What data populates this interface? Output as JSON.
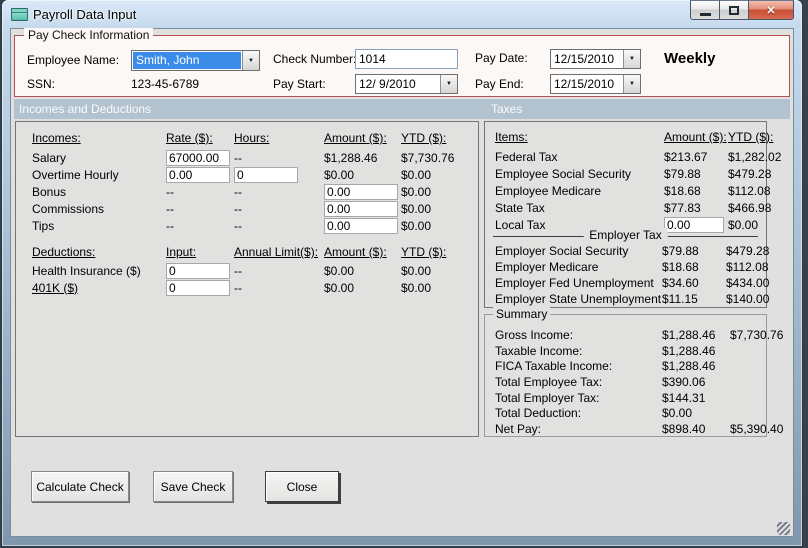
{
  "window": {
    "title": "Payroll Data Input"
  },
  "icons": {
    "combo_arrow": "▼",
    "close_glyph": "✕"
  },
  "paycheck": {
    "legend": "Pay Check Information",
    "employee_name_label": "Employee Name:",
    "employee_name_value": "Smith, John",
    "ssn_label": "SSN:",
    "ssn_value": "123-45-6789",
    "check_number_label": "Check Number:",
    "check_number_value": "1014",
    "pay_start_label": "Pay Start:",
    "pay_start_value": "12/ 9/2010",
    "pay_date_label": "Pay Date:",
    "pay_date_value": "12/15/2010",
    "pay_end_label": "Pay End:",
    "pay_end_value": "12/15/2010",
    "frequency": "Weekly"
  },
  "sections": {
    "left": "Incomes and Deductions",
    "right": "Taxes"
  },
  "incomes": {
    "headers": {
      "name": "Incomes:",
      "rate": "Rate ($):",
      "hours": "Hours:",
      "amount": "Amount ($):",
      "ytd": "YTD ($):"
    },
    "rows": [
      {
        "label": "Salary",
        "rate": "67000.00",
        "hours": "--",
        "amount": "$1,288.46",
        "ytd": "$7,730.76"
      },
      {
        "label": "Overtime Hourly",
        "rate": "0.00",
        "hours": "0",
        "amount": "$0.00",
        "ytd": "$0.00"
      },
      {
        "label": "Bonus",
        "rate": "--",
        "hours": "--",
        "amount": "0.00",
        "ytd": "$0.00"
      },
      {
        "label": "Commissions",
        "rate": "--",
        "hours": "--",
        "amount": "0.00",
        "ytd": "$0.00"
      },
      {
        "label": "Tips",
        "rate": "--",
        "hours": "--",
        "amount": "0.00",
        "ytd": "$0.00"
      }
    ]
  },
  "deductions": {
    "headers": {
      "name": "Deductions:",
      "input": "Input:",
      "limit": "Annual Limit($):",
      "amount": "Amount ($):",
      "ytd": "YTD ($):"
    },
    "rows": [
      {
        "label": "Health Insurance  ($)",
        "input": "0",
        "limit": "--",
        "amount": "$0.00",
        "ytd": "$0.00"
      },
      {
        "label": "401K  ($)",
        "input": "0",
        "limit": "--",
        "amount": "$0.00",
        "ytd": "$0.00"
      }
    ]
  },
  "taxes": {
    "headers": {
      "items": "Items:",
      "amount": "Amount ($):",
      "ytd": "YTD ($):"
    },
    "employee_rows": [
      {
        "label": "Federal Tax",
        "amount": "$213.67",
        "ytd": "$1,282.02"
      },
      {
        "label": "Employee Social Security",
        "amount": "$79.88",
        "ytd": "$479.28"
      },
      {
        "label": "Employee Medicare",
        "amount": "$18.68",
        "ytd": "$112.08"
      },
      {
        "label": "State Tax",
        "amount": "$77.83",
        "ytd": "$466.98"
      },
      {
        "label": "Local Tax",
        "amount": "0.00",
        "ytd": "$0.00"
      }
    ],
    "employer_label": "Employer Tax",
    "employer_rows": [
      {
        "label": "Employer Social Security",
        "amount": "$79.88",
        "ytd": "$479.28"
      },
      {
        "label": "Employer Medicare",
        "amount": "$18.68",
        "ytd": "$112.08"
      },
      {
        "label": "Employer Fed Unemployment",
        "amount": "$34.60",
        "ytd": "$434.00"
      },
      {
        "label": "Employer State Unemployment",
        "amount": "$11.15",
        "ytd": "$140.00"
      }
    ]
  },
  "summary": {
    "legend": "Summary",
    "rows": [
      {
        "label": "Gross Income:",
        "amount": "$1,288.46",
        "ytd": "$7,730.76"
      },
      {
        "label": "Taxable Income:",
        "amount": "$1,288.46",
        "ytd": ""
      },
      {
        "label": "FICA Taxable Income:",
        "amount": "$1,288.46",
        "ytd": ""
      },
      {
        "label": "Total Employee Tax:",
        "amount": "$390.06",
        "ytd": ""
      },
      {
        "label": "Total Employer Tax:",
        "amount": "$144.31",
        "ytd": ""
      },
      {
        "label": "Total Deduction:",
        "amount": "$0.00",
        "ytd": ""
      },
      {
        "label": "Net Pay:",
        "amount": "$898.40",
        "ytd": "$5,390.40"
      }
    ]
  },
  "buttons": {
    "calculate": "Calculate Check",
    "save": "Save Check",
    "close": "Close"
  },
  "colors": {
    "group_border": "#b25250",
    "section_bar": "#b2c2cf",
    "selection_blue": "#3a8ce8",
    "client_bg": "#e0e0e0",
    "paybox_bg": "#fcf8f6"
  }
}
